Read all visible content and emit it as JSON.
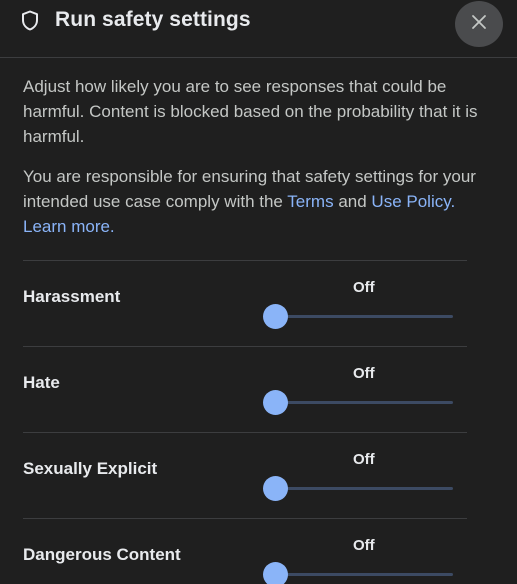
{
  "header": {
    "icon": "shield-icon",
    "title": "Run safety settings",
    "close_icon": "close-icon"
  },
  "description": {
    "p1": "Adjust how likely you are to see responses that could be harmful. Content is blocked based on the probability that it is harmful.",
    "p2_text": "You are responsible for ensuring that safety settings for your intended use case comply with the",
    "p2_terms": "Terms",
    "p2_and": "and",
    "p2_use_policy": "Use Policy.",
    "p2_learn_more": "Learn more."
  },
  "settings": [
    {
      "label": "Harassment",
      "value": "Off",
      "level": 0
    },
    {
      "label": "Hate",
      "value": "Off",
      "level": 0
    },
    {
      "label": "Sexually Explicit",
      "value": "Off",
      "level": 0
    },
    {
      "label": "Dangerous Content",
      "value": "Off",
      "level": 0
    }
  ],
  "colors": {
    "background": "#1f1f1f",
    "accent": "#8ab4f8",
    "track": "#3c4a63",
    "text": "#e8eaed",
    "muted_text": "#c4c7c5"
  }
}
